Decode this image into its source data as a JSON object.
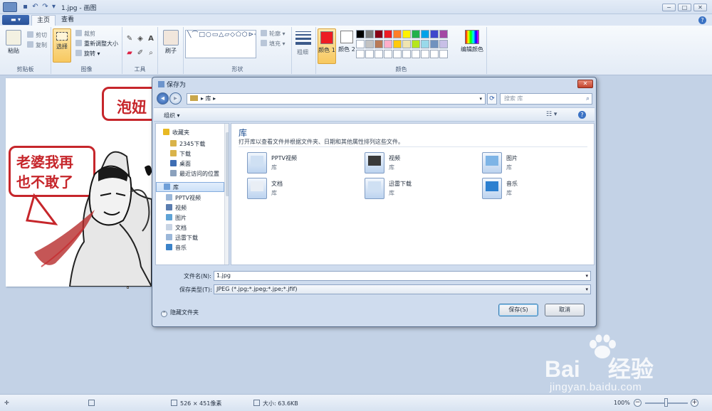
{
  "titlebar": {
    "document_title": "1.jpg - 画图",
    "minimize": "−",
    "maximize": "□",
    "close": "✕"
  },
  "ribbon_tabs": {
    "file": "▬ ▾",
    "home": "主页",
    "view": "查看",
    "help": "?"
  },
  "ribbon": {
    "clipboard": {
      "label": "剪贴板",
      "paste": "粘贴",
      "cut": "剪切",
      "copy": "复制"
    },
    "image": {
      "label": "图像",
      "select": "选择",
      "crop": "裁剪",
      "resize": "重新调整大小",
      "rotate": "旋转"
    },
    "tools": {
      "label": "工具"
    },
    "brushes": {
      "label": "刷子"
    },
    "shapes": {
      "label": "形状",
      "outline": "轮廓",
      "fill": "填充",
      "glyphs": "╲⌒□○▭△▱◇⬠⬡⊳⇨⇩⇦⇧✦☆✶▭◯♡⚡",
      "size": "粗细"
    },
    "colors": {
      "label": "颜色",
      "color1": "颜色 1",
      "color2": "颜色 2",
      "edit": "编辑颜色",
      "color1_value": "#ed1c24",
      "color2_value": "#ffffff",
      "palette": [
        "#000000",
        "#7f7f7f",
        "#880015",
        "#ed1c24",
        "#ff7f27",
        "#fff200",
        "#22b14c",
        "#00a2e8",
        "#3f48cc",
        "#a349a4",
        "#ffffff",
        "#c3c3c3",
        "#b97a57",
        "#ffaec9",
        "#ffc90e",
        "#efe4b0",
        "#b5e61d",
        "#99d9ea",
        "#7092be",
        "#c8bfe7",
        "#ffffff",
        "#ffffff",
        "#ffffff",
        "#ffffff",
        "#ffffff",
        "#ffffff",
        "#ffffff",
        "#ffffff",
        "#ffffff",
        "#ffffff"
      ]
    }
  },
  "canvas": {
    "bubble_top": "泡妞",
    "bubble_left_line1": "老婆我再",
    "bubble_left_line2": "也不敢了"
  },
  "statusbar": {
    "dimensions": "526 × 451像素",
    "filesize": "大小: 63.6KB",
    "zoom": "100%",
    "zoom_minus": "−",
    "zoom_plus": "+",
    "zoom_level": 0.5
  },
  "dialog": {
    "title": "保存为",
    "close": "✕",
    "address": "▸ 库 ▸",
    "search_placeholder": "搜索 库",
    "organize": "组织 ▾",
    "help": "?",
    "nav": [
      {
        "label": "收藏夹",
        "color": "#e8b923"
      },
      {
        "label": "2345下载",
        "color": "#d9b34a"
      },
      {
        "label": "下载",
        "color": "#d9b34a"
      },
      {
        "label": "桌面",
        "color": "#3e6db3"
      },
      {
        "label": "最近访问的位置",
        "color": "#8ba1bd"
      },
      {
        "label": "库",
        "color": "#6f9fd8"
      },
      {
        "label": "PPTV视频",
        "color": "#9bb7d9"
      },
      {
        "label": "视频",
        "color": "#5a7db0"
      },
      {
        "label": "图片",
        "color": "#5fa3d6"
      },
      {
        "label": "文档",
        "color": "#c8d4e4"
      },
      {
        "label": "迅雷下载",
        "color": "#9bb7d9"
      },
      {
        "label": "音乐",
        "color": "#3b83c9"
      }
    ],
    "library_title": "库",
    "library_subtitle": "打开库以查看文件并根据文件夹、日期和其他属性排列这些文件。",
    "libraries": [
      {
        "name": "PPTV视频",
        "type": "库",
        "color": "#cfe0f3"
      },
      {
        "name": "视频",
        "type": "库",
        "color": "#3a3a3a"
      },
      {
        "name": "图片",
        "type": "库",
        "color": "#7db4e6"
      },
      {
        "name": "文档",
        "type": "库",
        "color": "#e9eef5"
      },
      {
        "name": "迅雷下载",
        "type": "库",
        "color": "#cfe0f3"
      },
      {
        "name": "音乐",
        "type": "库",
        "color": "#2b7fd0"
      }
    ],
    "filename_label": "文件名(N):",
    "filename_value": "1.jpg",
    "filetype_label": "保存类型(T):",
    "filetype_value": "JPEG (*.jpg;*.jpeg;*.jpe;*.jfif)",
    "hide_folders": "隐藏文件夹",
    "save": "保存(S)",
    "cancel": "取消"
  },
  "watermark": {
    "logo": "Baidu经验",
    "url": "jingyan.baidu.com"
  }
}
